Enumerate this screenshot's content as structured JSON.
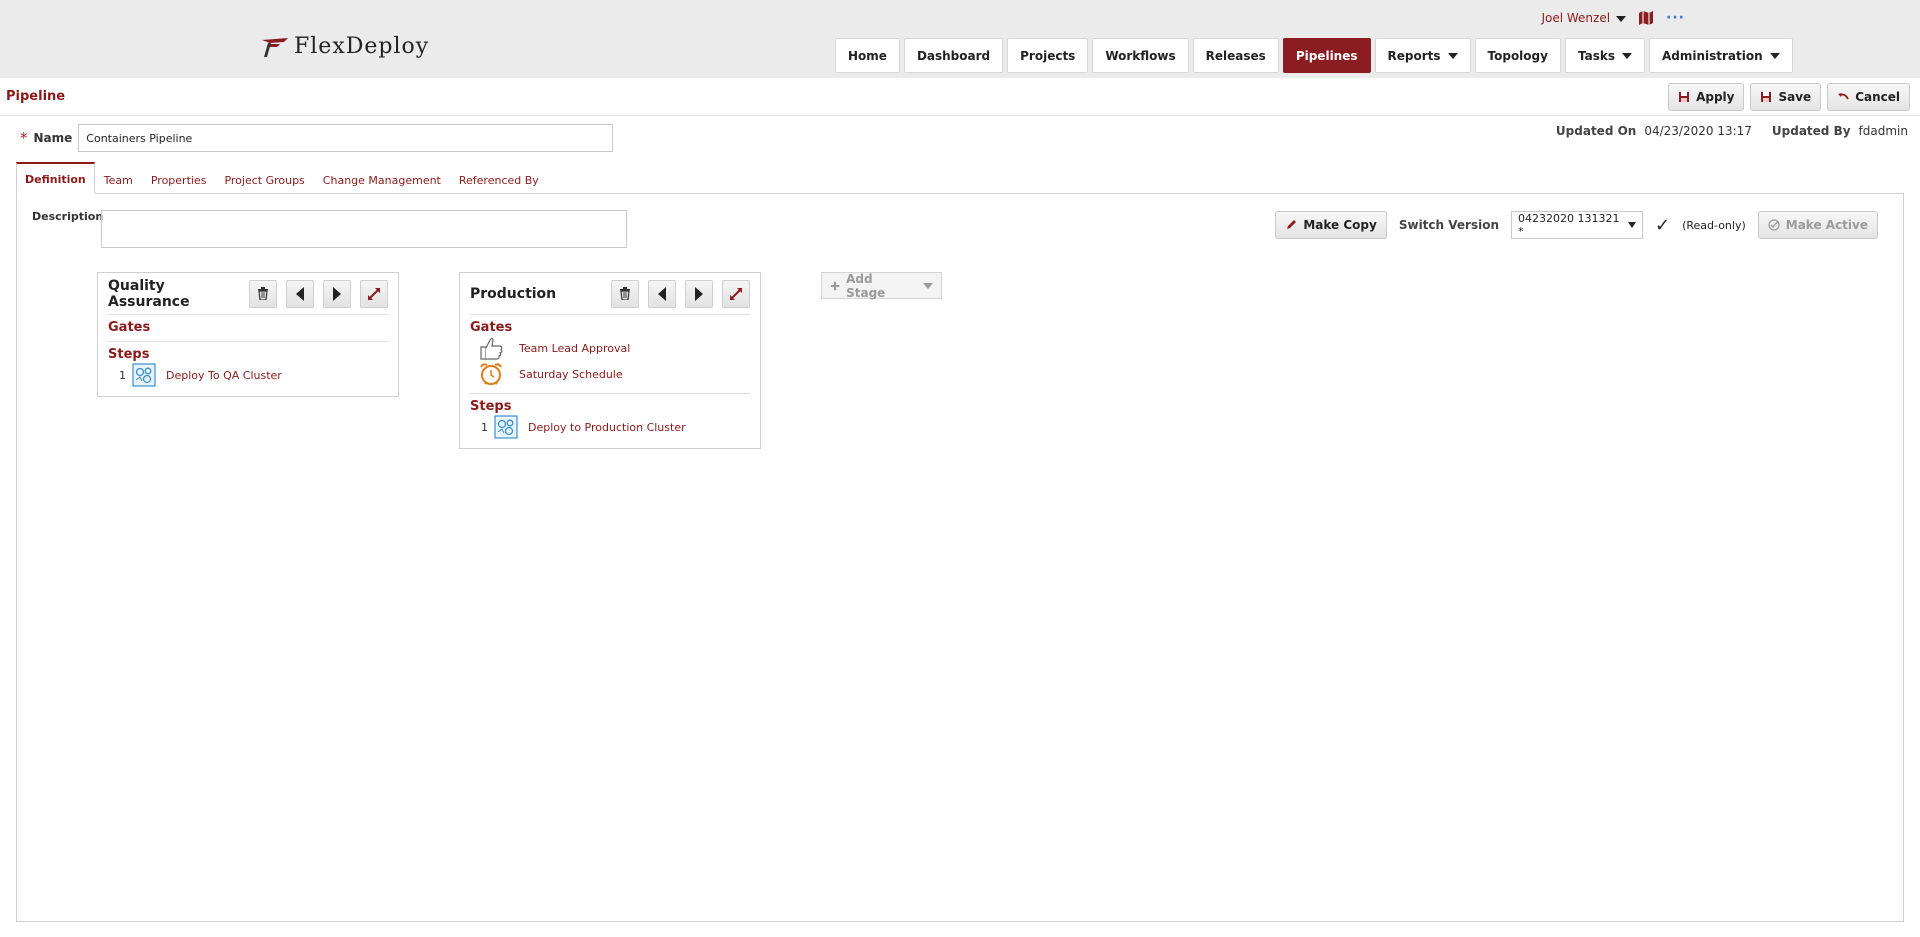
{
  "header": {
    "logo_text": "FlexDeploy",
    "user": "Joel Wenzel",
    "nav": [
      {
        "label": "Home",
        "dropdown": false
      },
      {
        "label": "Dashboard",
        "dropdown": false
      },
      {
        "label": "Projects",
        "dropdown": false
      },
      {
        "label": "Workflows",
        "dropdown": false
      },
      {
        "label": "Releases",
        "dropdown": false
      },
      {
        "label": "Pipelines",
        "dropdown": false,
        "active": true
      },
      {
        "label": "Reports",
        "dropdown": true
      },
      {
        "label": "Topology",
        "dropdown": false
      },
      {
        "label": "Tasks",
        "dropdown": true
      },
      {
        "label": "Administration",
        "dropdown": true
      }
    ]
  },
  "page": {
    "title": "Pipeline",
    "actions": {
      "apply": "Apply",
      "save": "Save",
      "cancel": "Cancel"
    },
    "name_label": "Name",
    "name_value": "Containers Pipeline",
    "updated_on_label": "Updated On",
    "updated_on_value": "04/23/2020 13:17",
    "updated_by_label": "Updated By",
    "updated_by_value": "fdadmin"
  },
  "tabs": [
    "Definition",
    "Team",
    "Properties",
    "Project Groups",
    "Change Management",
    "Referenced By"
  ],
  "definition": {
    "description_label": "Description",
    "make_copy": "Make Copy",
    "switch_version_label": "Switch Version",
    "version_value": "04232020 131321 *",
    "readonly": "(Read-only)",
    "make_active": "Make Active",
    "add_stage": "Add Stage"
  },
  "stages": [
    {
      "title": "Quality Assurance",
      "gates_label": "Gates",
      "gates": [],
      "steps_label": "Steps",
      "steps": [
        {
          "num": "1",
          "label": "Deploy To QA Cluster"
        }
      ]
    },
    {
      "title": "Production",
      "gates_label": "Gates",
      "gates": [
        {
          "label": "Team Lead Approval",
          "icon": "thumbs-up-icon"
        },
        {
          "label": "Saturday Schedule",
          "icon": "alarm-clock-icon"
        }
      ],
      "steps_label": "Steps",
      "steps": [
        {
          "num": "1",
          "label": "Deploy to Production Cluster"
        }
      ]
    }
  ],
  "colors": {
    "brand": "#8b1c22",
    "link": "#8b1a1a"
  }
}
